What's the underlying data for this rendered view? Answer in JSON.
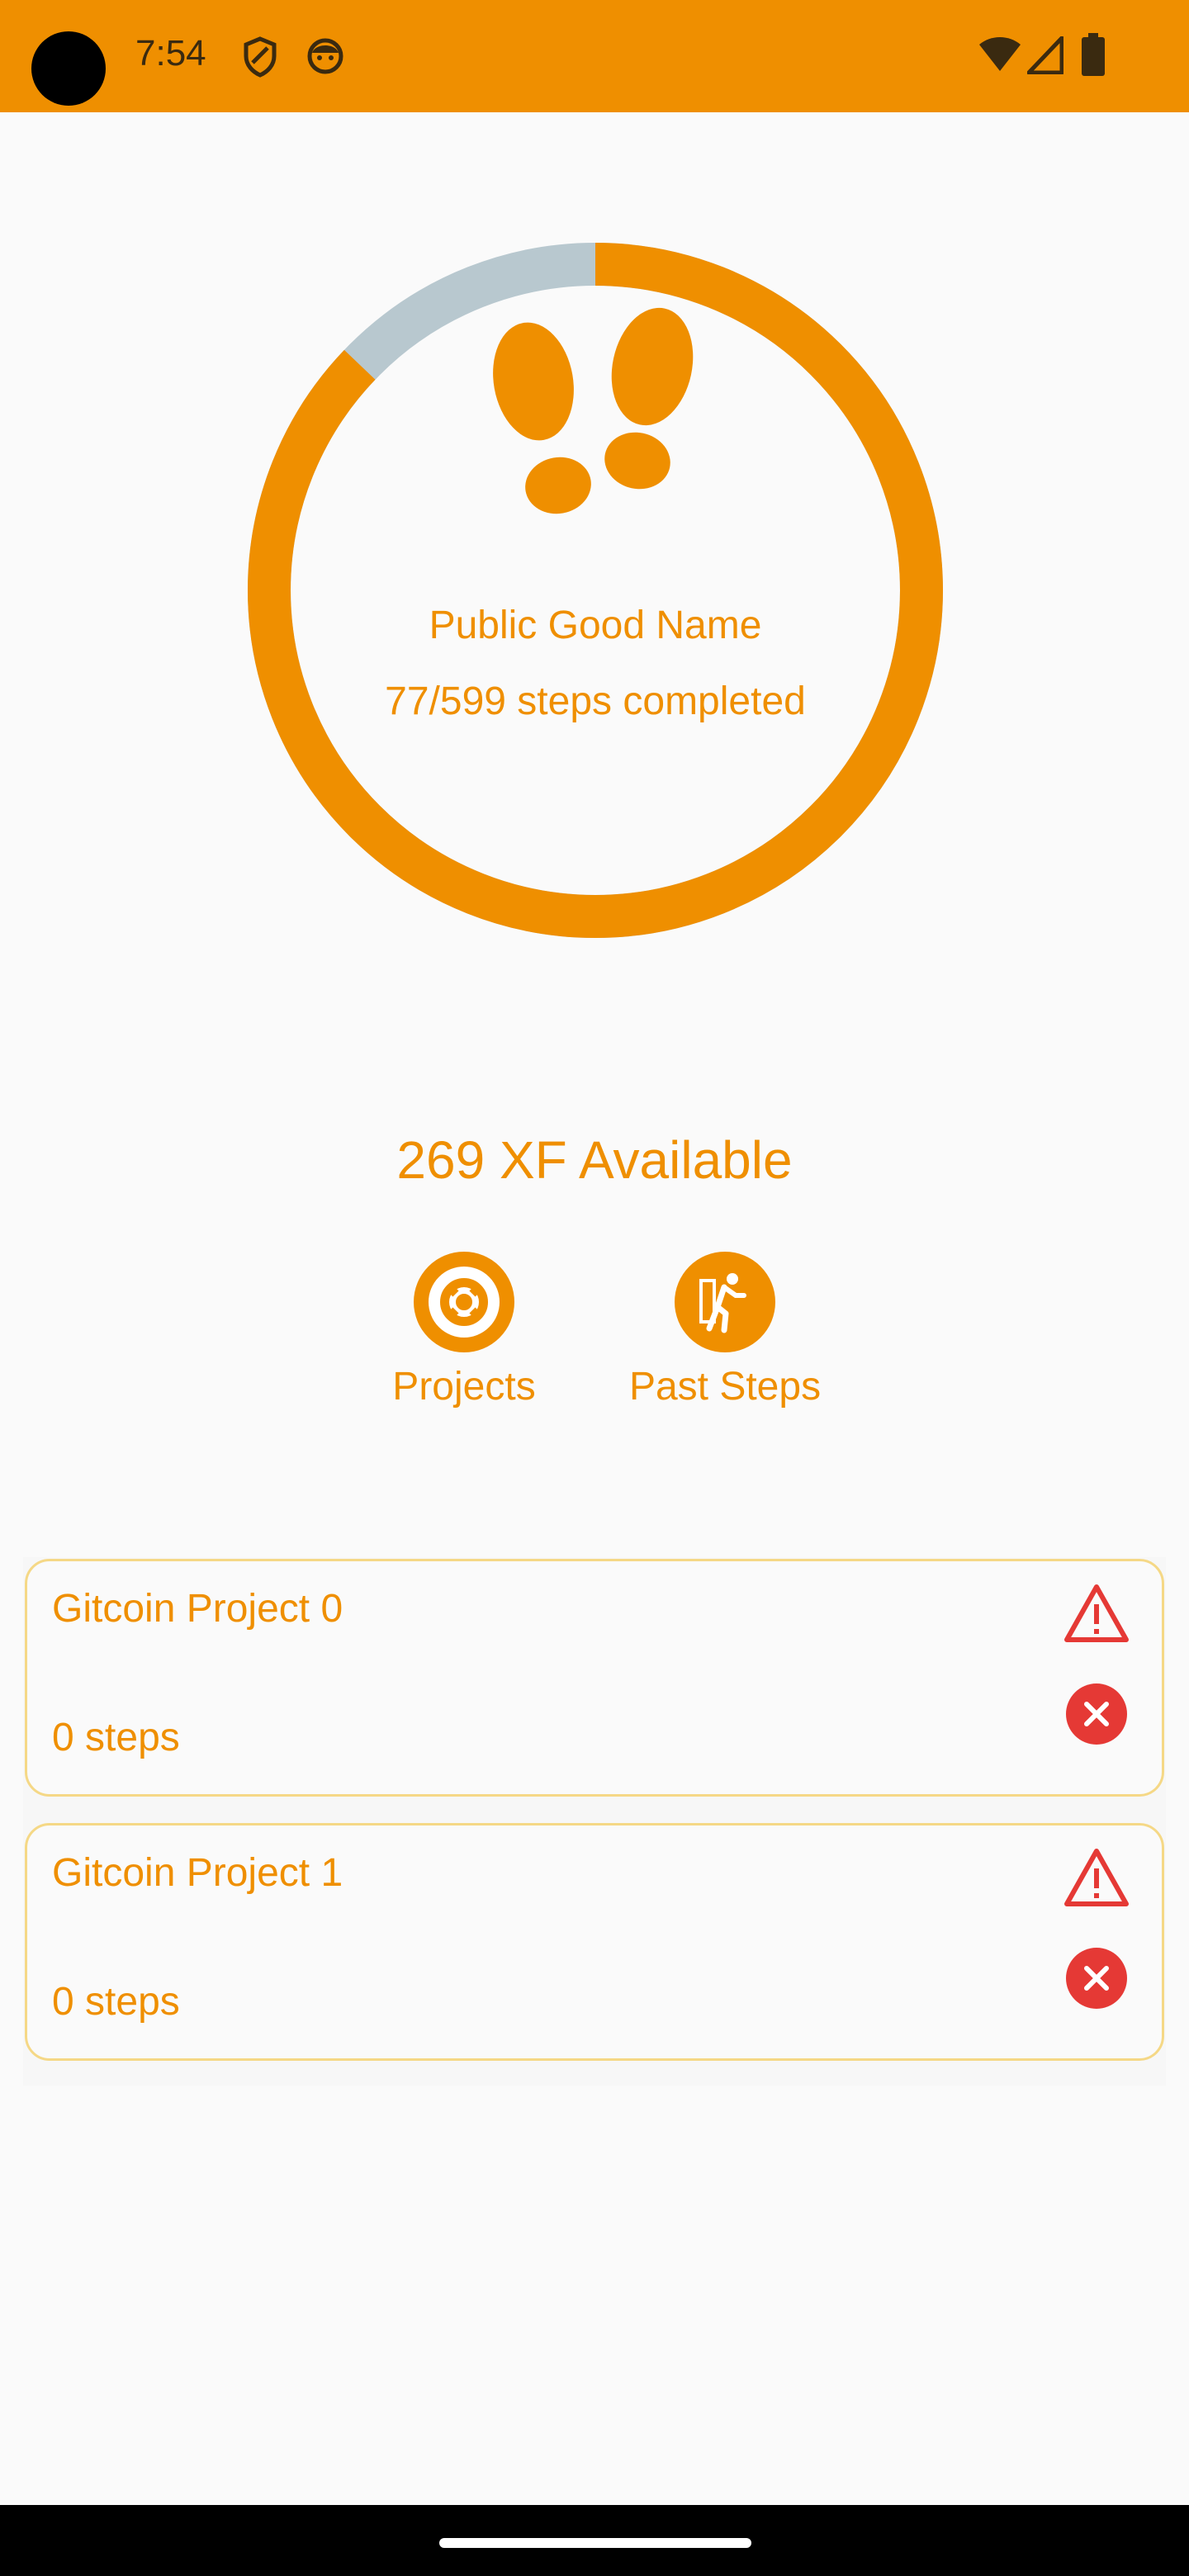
{
  "status_bar": {
    "time": "7:54",
    "left_icons": [
      "shield-icon",
      "face-icon"
    ],
    "right_icons": [
      "wifi-icon",
      "signal-icon",
      "battery-icon"
    ],
    "color": "#ef8f00"
  },
  "progress": {
    "name": "Public Good Name",
    "steps_text": "77/599 steps completed",
    "completed": 77,
    "total": 599,
    "ring_color": "#ef8f00",
    "ring_track_color": "#b8c8cf",
    "icon": "footprints-icon"
  },
  "balance": {
    "text": "269 XF Available"
  },
  "actions": [
    {
      "label": "Projects",
      "icon": "lifebuoy-icon"
    },
    {
      "label": "Past Steps",
      "icon": "running-icon"
    }
  ],
  "projects": [
    {
      "title": "Gitcoin Project 0",
      "steps": "0 steps"
    },
    {
      "title": "Gitcoin Project 1",
      "steps": "0 steps"
    }
  ],
  "colors": {
    "accent": "#ef8f00",
    "card_border": "#f5d886",
    "warning": "#e53935",
    "background": "#fafafa"
  }
}
